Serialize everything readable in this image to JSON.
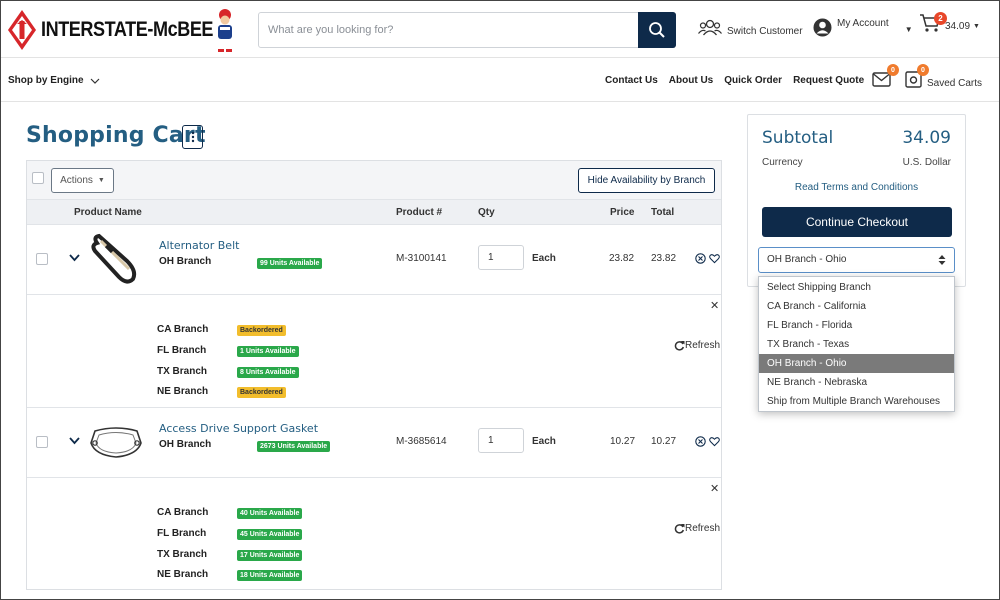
{
  "header": {
    "logo_text": "INTERSTATE-McBEE",
    "search_placeholder": "What are you looking for?",
    "switch_customer": "Switch Customer",
    "my_account": "My Account",
    "cart_count": "2",
    "cart_total": "34.09"
  },
  "nav": {
    "shop_by_engine": "Shop by Engine",
    "links": [
      "Contact Us",
      "About Us",
      "Quick Order",
      "Request Quote"
    ],
    "messages_count": "0",
    "saved_carts_count": "0",
    "saved_carts": "Saved Carts"
  },
  "page": {
    "title": "Shopping Cart"
  },
  "cart": {
    "actions_label": "Actions",
    "hide_availability_label": "Hide Availability by Branch",
    "columns": {
      "product_name": "Product Name",
      "product_num": "Product #",
      "qty": "Qty",
      "price": "Price",
      "total": "Total"
    },
    "items": [
      {
        "name": "Alternator Belt",
        "branch": "OH Branch",
        "availability": "99 Units Available",
        "product_num": "M-3100141",
        "qty": "1",
        "unit": "Each",
        "price": "23.82",
        "total": "23.82",
        "branches": [
          {
            "name": "CA Branch",
            "status": "Backordered",
            "color": "yellow"
          },
          {
            "name": "FL Branch",
            "status": "1 Units Available",
            "color": "green"
          },
          {
            "name": "TX Branch",
            "status": "8 Units Available",
            "color": "green"
          },
          {
            "name": "NE Branch",
            "status": "Backordered",
            "color": "yellow"
          }
        ],
        "refresh": "Refresh"
      },
      {
        "name": "Access Drive Support Gasket",
        "branch": "OH Branch",
        "availability": "2673 Units Available",
        "product_num": "M-3685614",
        "qty": "1",
        "unit": "Each",
        "price": "10.27",
        "total": "10.27",
        "branches": [
          {
            "name": "CA Branch",
            "status": "40 Units Available",
            "color": "green"
          },
          {
            "name": "FL Branch",
            "status": "45 Units Available",
            "color": "green"
          },
          {
            "name": "TX Branch",
            "status": "17 Units Available",
            "color": "green"
          },
          {
            "name": "NE Branch",
            "status": "18 Units Available",
            "color": "green"
          }
        ],
        "refresh": "Refresh"
      }
    ]
  },
  "summary": {
    "subtotal_label": "Subtotal",
    "subtotal_amount": "34.09",
    "currency_label": "Currency",
    "currency_value": "U.S. Dollar",
    "terms": "Read Terms and Conditions",
    "checkout": "Continue Checkout",
    "selected_branch": "OH Branch - Ohio",
    "branch_options": [
      "Select Shipping Branch",
      "CA Branch - California",
      "FL Branch - Florida",
      "TX Branch - Texas",
      "OH Branch - Ohio",
      "NE Branch - Nebraska",
      "Ship from Multiple Branch Warehouses"
    ]
  },
  "colors": {
    "navy": "#0e2a4a",
    "title_blue": "#245e82",
    "available_green": "#2aa84a",
    "backorder_yellow": "#f2bd2c",
    "badge_red": "#e8472a",
    "badge_orange": "#f07b2d"
  }
}
